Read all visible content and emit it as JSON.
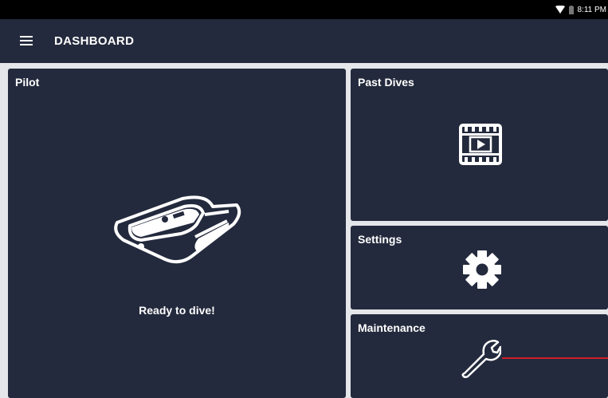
{
  "status_bar": {
    "time": "8:11 PM",
    "icons": [
      "wifi-icon",
      "battery-icon"
    ]
  },
  "app_bar": {
    "menu_icon": "hamburger-menu-icon",
    "title": "DASHBOARD"
  },
  "cards": {
    "pilot": {
      "title": "Pilot",
      "icon": "rov-drone-icon",
      "status": "Ready to dive!"
    },
    "past_dives": {
      "title": "Past Dives",
      "icon": "film-play-icon"
    },
    "settings": {
      "title": "Settings",
      "icon": "gear-icon"
    },
    "maintenance": {
      "title": "Maintenance",
      "icon": "wrench-icon"
    }
  },
  "colors": {
    "panel": "#242a3d",
    "background": "#e4e6ea",
    "accent": "#cf1f2a"
  }
}
